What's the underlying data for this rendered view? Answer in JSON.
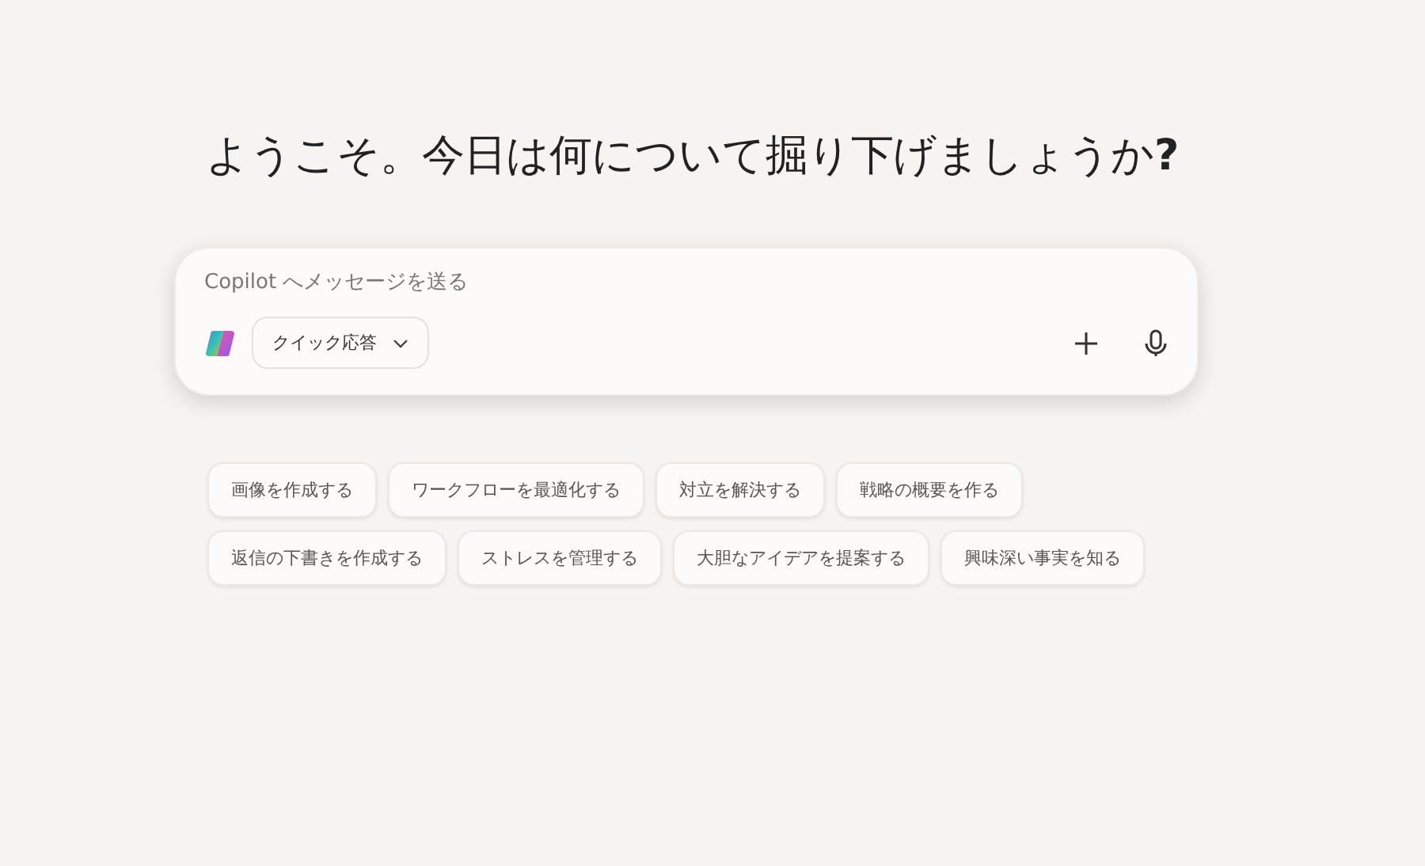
{
  "heading": "ようこそ。今日は何について掘り下げましょうか**?**",
  "composer": {
    "placeholder": "Copilot へメッセージを送る",
    "mode": "クイック応答"
  },
  "suggestions": [
    [
      "画像を作成する",
      "ワークフローを最適化する",
      "対立を解決する",
      "戦略の概要を作る"
    ],
    [
      "返信の下書きを作成する",
      "ストレスを管理する",
      "大胆なアイデアを提案する",
      "興味深い事実を知る"
    ]
  ]
}
